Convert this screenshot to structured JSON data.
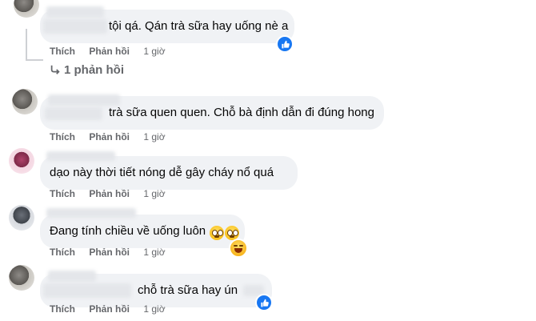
{
  "comments": [
    {
      "text": "tội qá. Qán trà sữa hay uống nè a",
      "like": "Thích",
      "reply": "Phản hồi",
      "time": "1 giờ"
    },
    {
      "text": "trà sữa quen quen. Chỗ bà định dẫn đi đúng hong",
      "like": "Thích",
      "reply": "Phản hồi",
      "time": "1 giờ"
    },
    {
      "text": "dạo này thời tiết nóng dễ gây cháy nổ quá",
      "like": "Thích",
      "reply": "Phản hồi",
      "time": "1 giờ"
    },
    {
      "text": "Đang tính chiều về uống luôn",
      "like": "Thích",
      "reply": "Phản hồi",
      "time": "1 giờ"
    },
    {
      "text": "chỗ trà sữa hay ún",
      "like": "Thích",
      "reply": "Phản hồi",
      "time": "1 giờ"
    }
  ],
  "replies_link": "1 phản hồi",
  "icons": {
    "reply_arrow": "reply-arrow-icon",
    "like_reaction": "thumbs-up-icon",
    "dizzy_emoji": "dizzy-face-emoji",
    "laugh_emoji": "laughing-emoji"
  },
  "colors": {
    "like_blue": "#1877f2",
    "bubble_bg": "#f0f2f5",
    "meta_gray": "#65676b"
  }
}
